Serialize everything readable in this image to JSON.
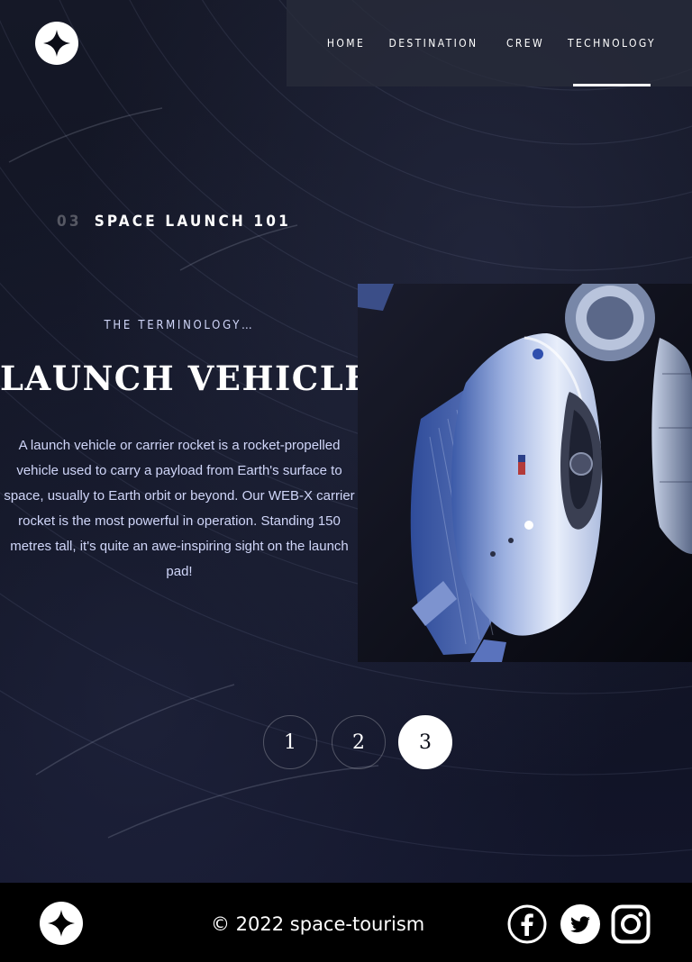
{
  "header": {
    "logo_icon": "star-logo-icon",
    "nav": [
      {
        "label": "HOME",
        "active": false
      },
      {
        "label": "DESTINATION",
        "active": false
      },
      {
        "label": "CREW",
        "active": false
      },
      {
        "label": "TECHNOLOGY",
        "active": true
      }
    ]
  },
  "page": {
    "heading_number": "03",
    "heading_text": "SPACE LAUNCH 101"
  },
  "technology": {
    "eyebrow": "THE TERMINOLOGY…",
    "title": "LAUNCH VEHICLE",
    "description": "A launch vehicle or carrier rocket is a rocket-propelled vehicle used to carry a payload from Earth's surface to space, usually to Earth orbit or beyond. Our WEB-X carrier rocket is the most powerful in operation. Standing 150 metres tall, it's quite an awe-inspiring sight on the launch pad!",
    "image_icon": "space-capsule-image"
  },
  "pagination": {
    "pages": [
      "1",
      "2",
      "3"
    ],
    "active_index": 2
  },
  "footer": {
    "copyright": "© 2022 space-tourism",
    "social": [
      "facebook-icon",
      "twitter-icon",
      "instagram-icon"
    ]
  },
  "colors": {
    "background": "#0b0d17",
    "accent": "#d0d6f9",
    "white": "#ffffff"
  }
}
